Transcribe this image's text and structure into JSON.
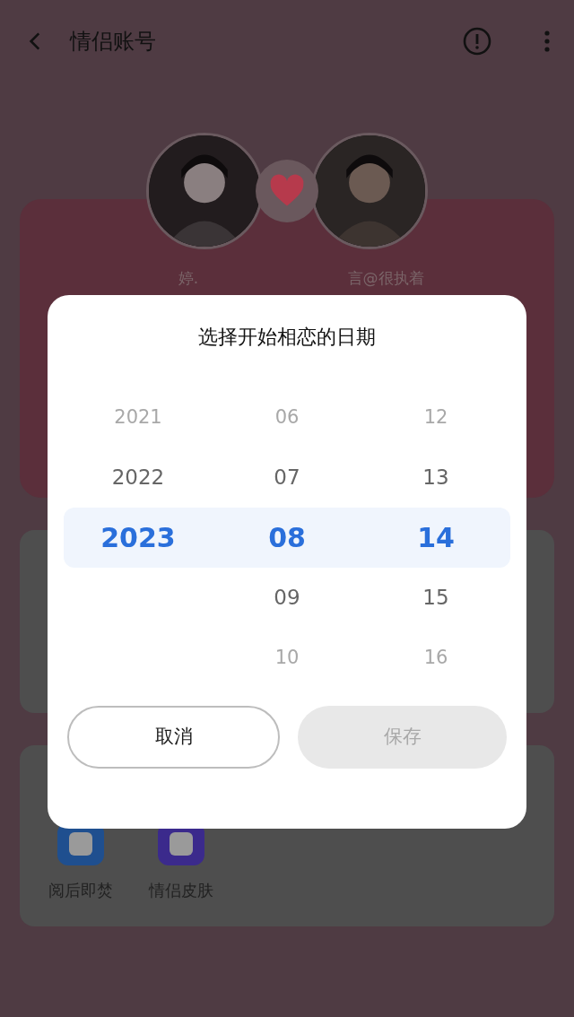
{
  "header": {
    "title": "情侣账号"
  },
  "couple": {
    "names": [
      "婷.",
      "言@很执着"
    ]
  },
  "features": [
    {
      "label": "阅后即焚",
      "color": "#1f4f8f"
    },
    {
      "label": "情侣皮肤",
      "color": "#3b2a8c"
    }
  ],
  "dialog": {
    "title": "选择开始相恋的日期",
    "columns": [
      {
        "items": [
          {
            "label": "2021",
            "selected": false
          },
          {
            "label": "2022",
            "selected": false
          },
          {
            "label": "2023",
            "selected": true
          }
        ]
      },
      {
        "items": [
          {
            "label": "06",
            "selected": false
          },
          {
            "label": "07",
            "selected": false
          },
          {
            "label": "08",
            "selected": true
          },
          {
            "label": "09",
            "selected": false
          },
          {
            "label": "10",
            "selected": false
          }
        ]
      },
      {
        "items": [
          {
            "label": "12",
            "selected": false
          },
          {
            "label": "13",
            "selected": false
          },
          {
            "label": "14",
            "selected": true
          },
          {
            "label": "15",
            "selected": false
          },
          {
            "label": "16",
            "selected": false
          }
        ]
      }
    ],
    "buttons": [
      {
        "label": "取消",
        "kind": "outline"
      },
      {
        "label": "保存",
        "kind": "disabled"
      }
    ]
  }
}
